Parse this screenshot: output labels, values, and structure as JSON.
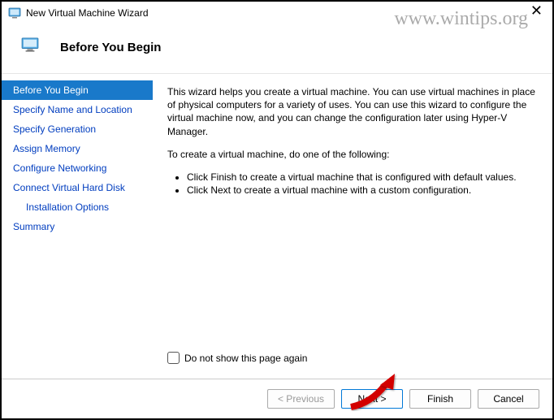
{
  "titlebar": {
    "title": "New Virtual Machine Wizard"
  },
  "watermark": "www.wintips.org",
  "header": {
    "title": "Before You Begin"
  },
  "sidebar": {
    "items": [
      {
        "label": "Before You Begin",
        "active": true
      },
      {
        "label": "Specify Name and Location",
        "active": false
      },
      {
        "label": "Specify Generation",
        "active": false
      },
      {
        "label": "Assign Memory",
        "active": false
      },
      {
        "label": "Configure Networking",
        "active": false
      },
      {
        "label": "Connect Virtual Hard Disk",
        "active": false
      },
      {
        "label": "Installation Options",
        "active": false,
        "indent": true
      },
      {
        "label": "Summary",
        "active": false
      }
    ]
  },
  "content": {
    "intro": "This wizard helps you create a virtual machine. You can use virtual machines in place of physical computers for a variety of uses. You can use this wizard to configure the virtual machine now, and you can change the configuration later using Hyper-V Manager.",
    "instruction": "To create a virtual machine, do one of the following:",
    "bullets": [
      "Click Finish to create a virtual machine that is configured with default values.",
      "Click Next to create a virtual machine with a custom configuration."
    ],
    "checkbox_label": "Do not show this page again"
  },
  "footer": {
    "previous": "< Previous",
    "next": "Next >",
    "finish": "Finish",
    "cancel": "Cancel"
  }
}
